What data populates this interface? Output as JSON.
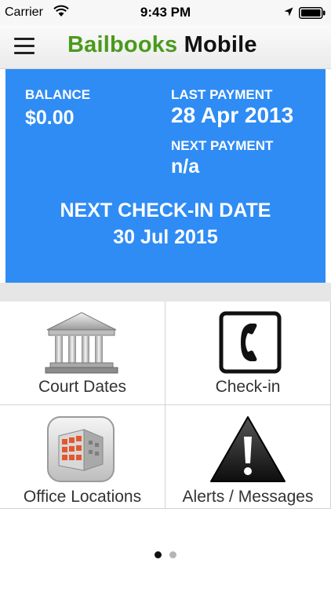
{
  "status_bar": {
    "carrier": "Carrier",
    "time": "9:43 PM"
  },
  "nav": {
    "title_brand": "Bailbooks",
    "title_suffix": "Mobile",
    "brand_color": "#4a9a1b"
  },
  "info": {
    "accent_color": "#2f8cf4",
    "balance_label": "BALANCE",
    "balance_value": "$0.00",
    "last_payment_label": "LAST PAYMENT",
    "last_payment_value": "28 Apr 2013",
    "next_payment_label": "NEXT PAYMENT",
    "next_payment_value": "n/a",
    "checkin_label": "NEXT CHECK-IN DATE",
    "checkin_value": "30 Jul 2015"
  },
  "tiles": [
    {
      "label": "Court Dates",
      "icon": "courthouse-icon"
    },
    {
      "label": "Check-in",
      "icon": "phone-icon"
    },
    {
      "label": "Office Locations",
      "icon": "office-building-icon"
    },
    {
      "label": "Alerts / Messages",
      "icon": "warning-icon"
    }
  ],
  "pager": {
    "page_count": 2,
    "current_page": 1
  }
}
